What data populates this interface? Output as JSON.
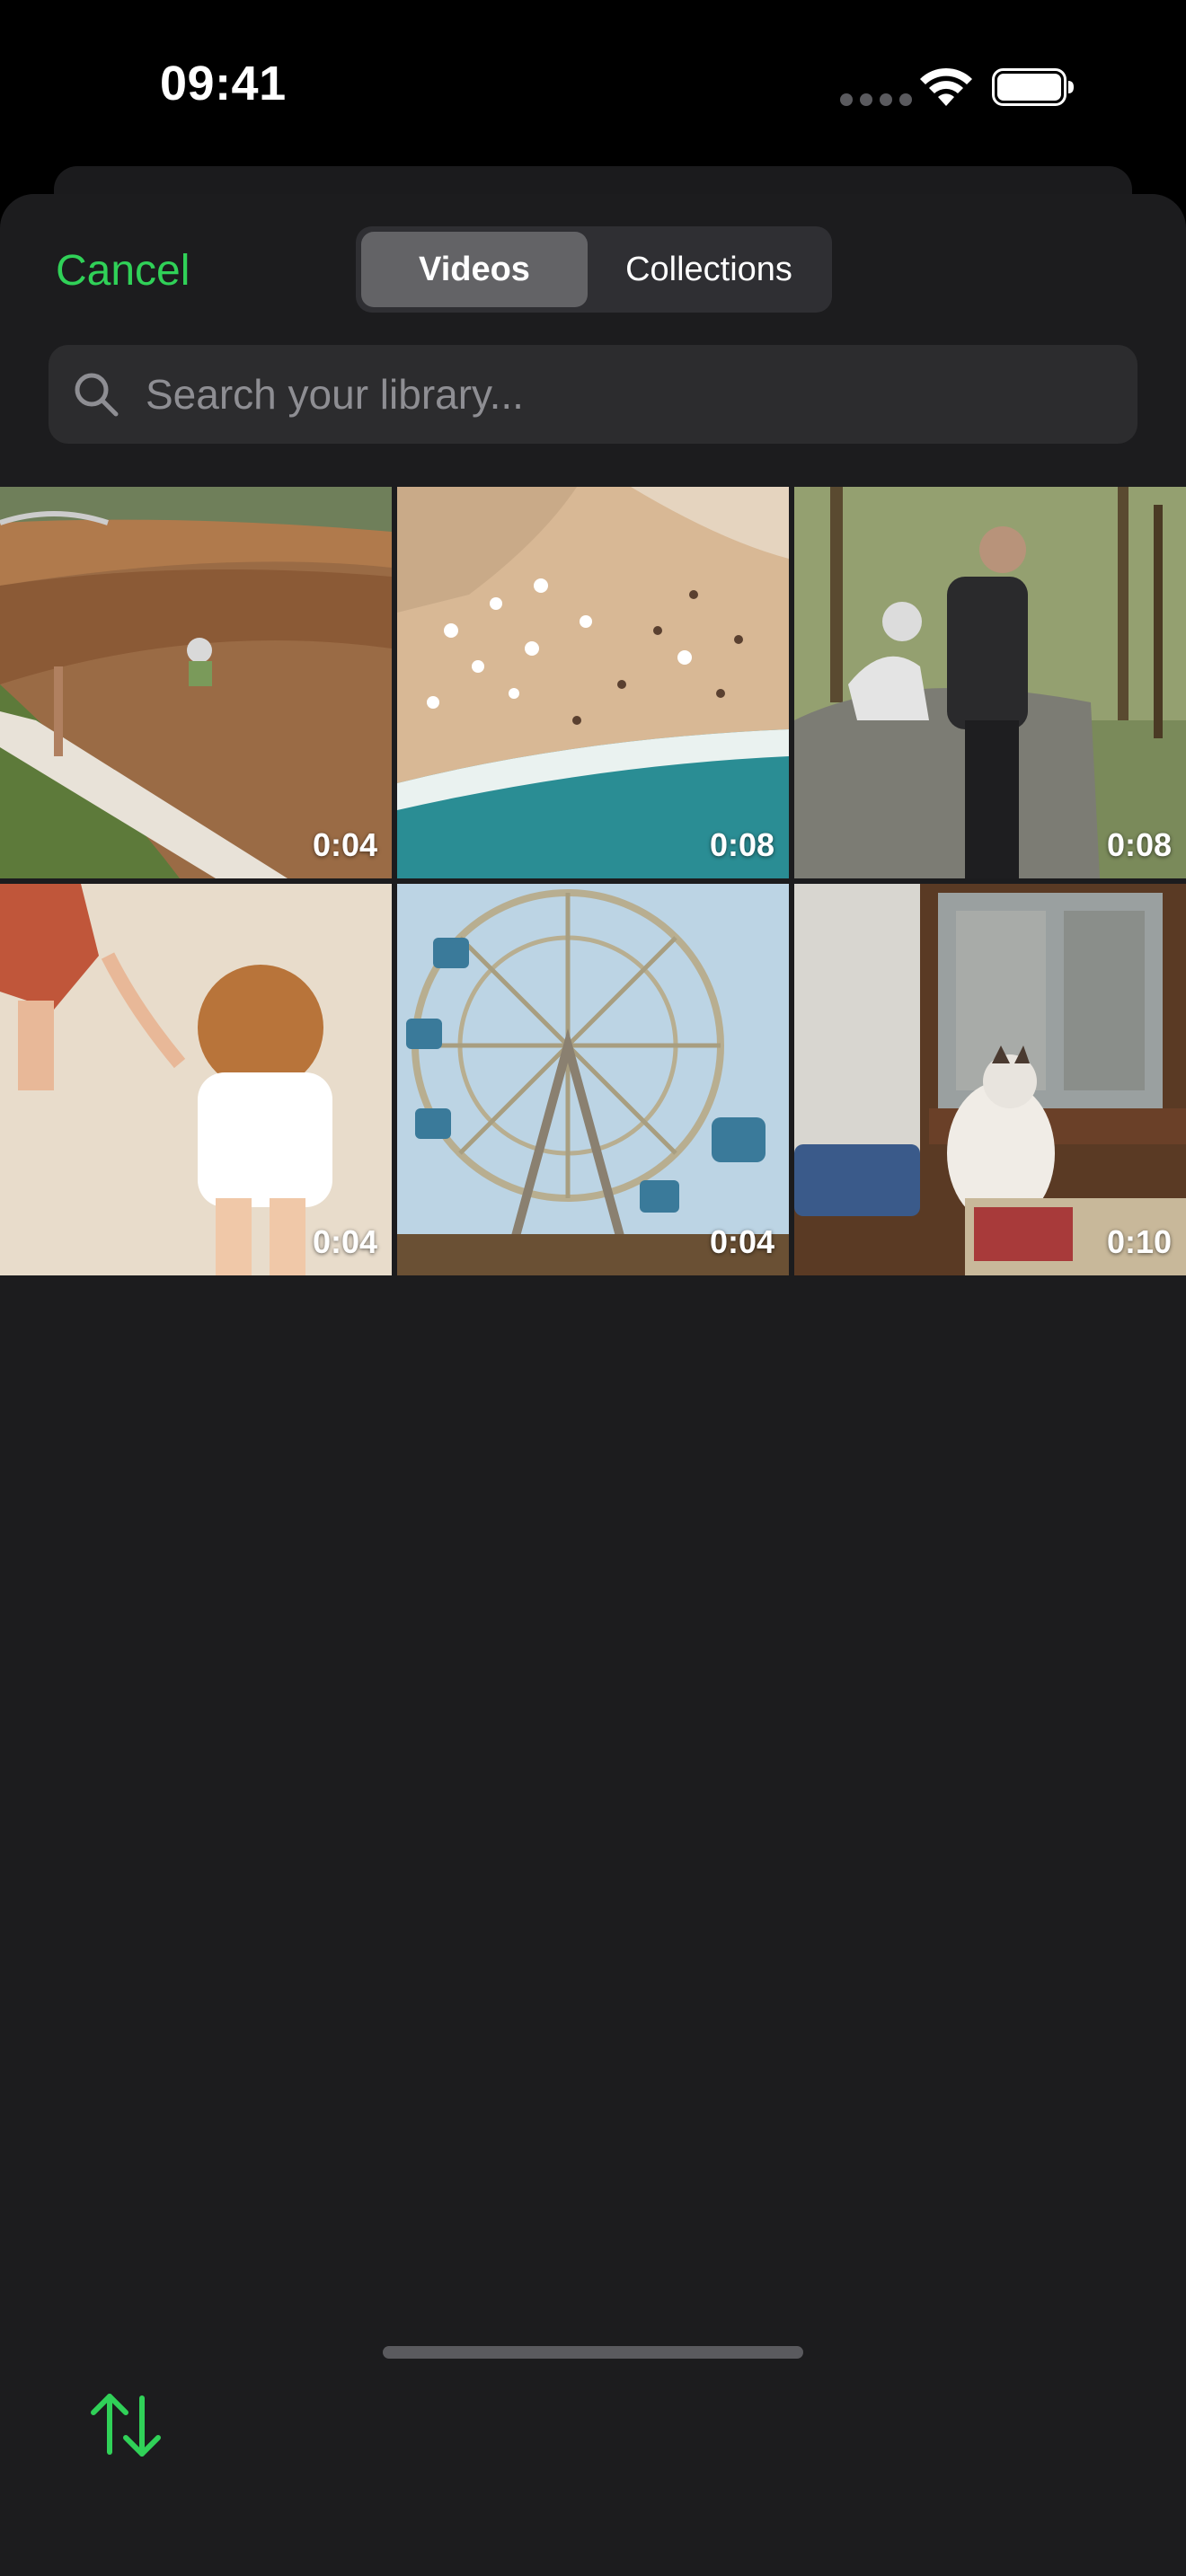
{
  "status_bar": {
    "time": "09:41"
  },
  "header": {
    "cancel_label": "Cancel",
    "tabs": [
      {
        "label": "Videos",
        "selected": true
      },
      {
        "label": "Collections",
        "selected": false
      }
    ]
  },
  "search": {
    "placeholder": "Search your library..."
  },
  "videos": [
    {
      "subject": "motocross dirt track",
      "duration": "0:04"
    },
    {
      "subject": "aerial beach with umbrellas",
      "duration": "0:08"
    },
    {
      "subject": "man with husky on rock",
      "duration": "0:08"
    },
    {
      "subject": "child holding hand on sand",
      "duration": "0:04"
    },
    {
      "subject": "ferris wheel",
      "duration": "0:04"
    },
    {
      "subject": "cat by window",
      "duration": "0:10"
    }
  ],
  "footer": {
    "sort_icon": "sort-arrows-icon"
  },
  "colors": {
    "accent": "#30d158",
    "sheet_background": "#1c1c1e",
    "segment_selected": "#636366"
  }
}
